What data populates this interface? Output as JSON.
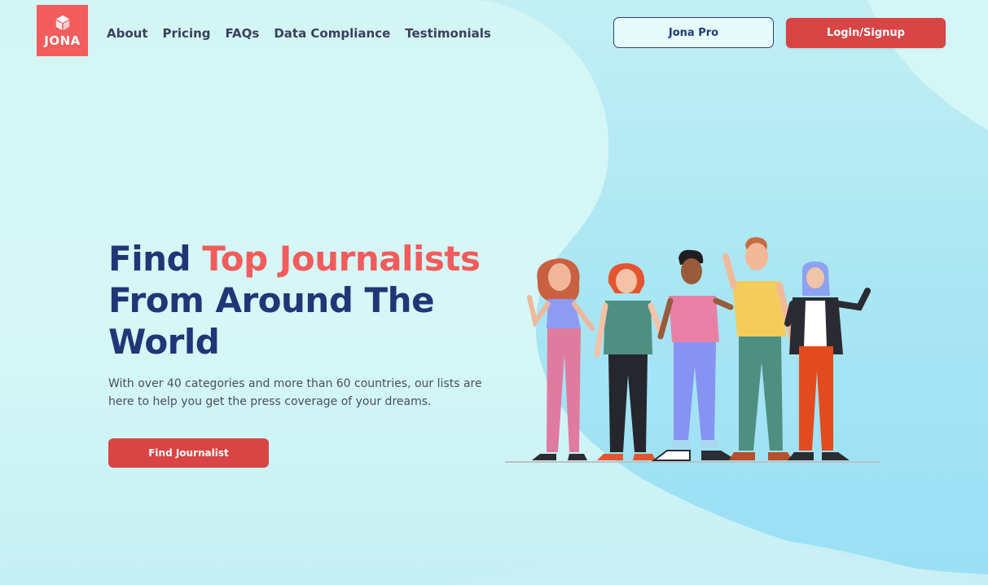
{
  "brand": {
    "name": "JONA"
  },
  "nav": {
    "items": [
      {
        "label": "About"
      },
      {
        "label": "Pricing"
      },
      {
        "label": "FAQs"
      },
      {
        "label": "Data Compliance"
      },
      {
        "label": "Testimonials"
      }
    ]
  },
  "header": {
    "pro_label": "Jona Pro",
    "login_label": "Login/Signup"
  },
  "hero": {
    "title_part1": "Find ",
    "title_accent": "Top Journalists",
    "title_line2": "From Around The",
    "title_line3": "World",
    "subtitle": "With over 40 categories and more than 60 countries, our lists are here to help you get the press coverage of your dreams.",
    "cta_label": "Find Journalist"
  },
  "colors": {
    "brand_red": "#f25c5c",
    "button_red": "#d94444",
    "navy": "#223577",
    "background": "#d3f6f5",
    "blob_blue": "#a8e6f4"
  },
  "icons": {
    "logo": "cube-icon"
  }
}
